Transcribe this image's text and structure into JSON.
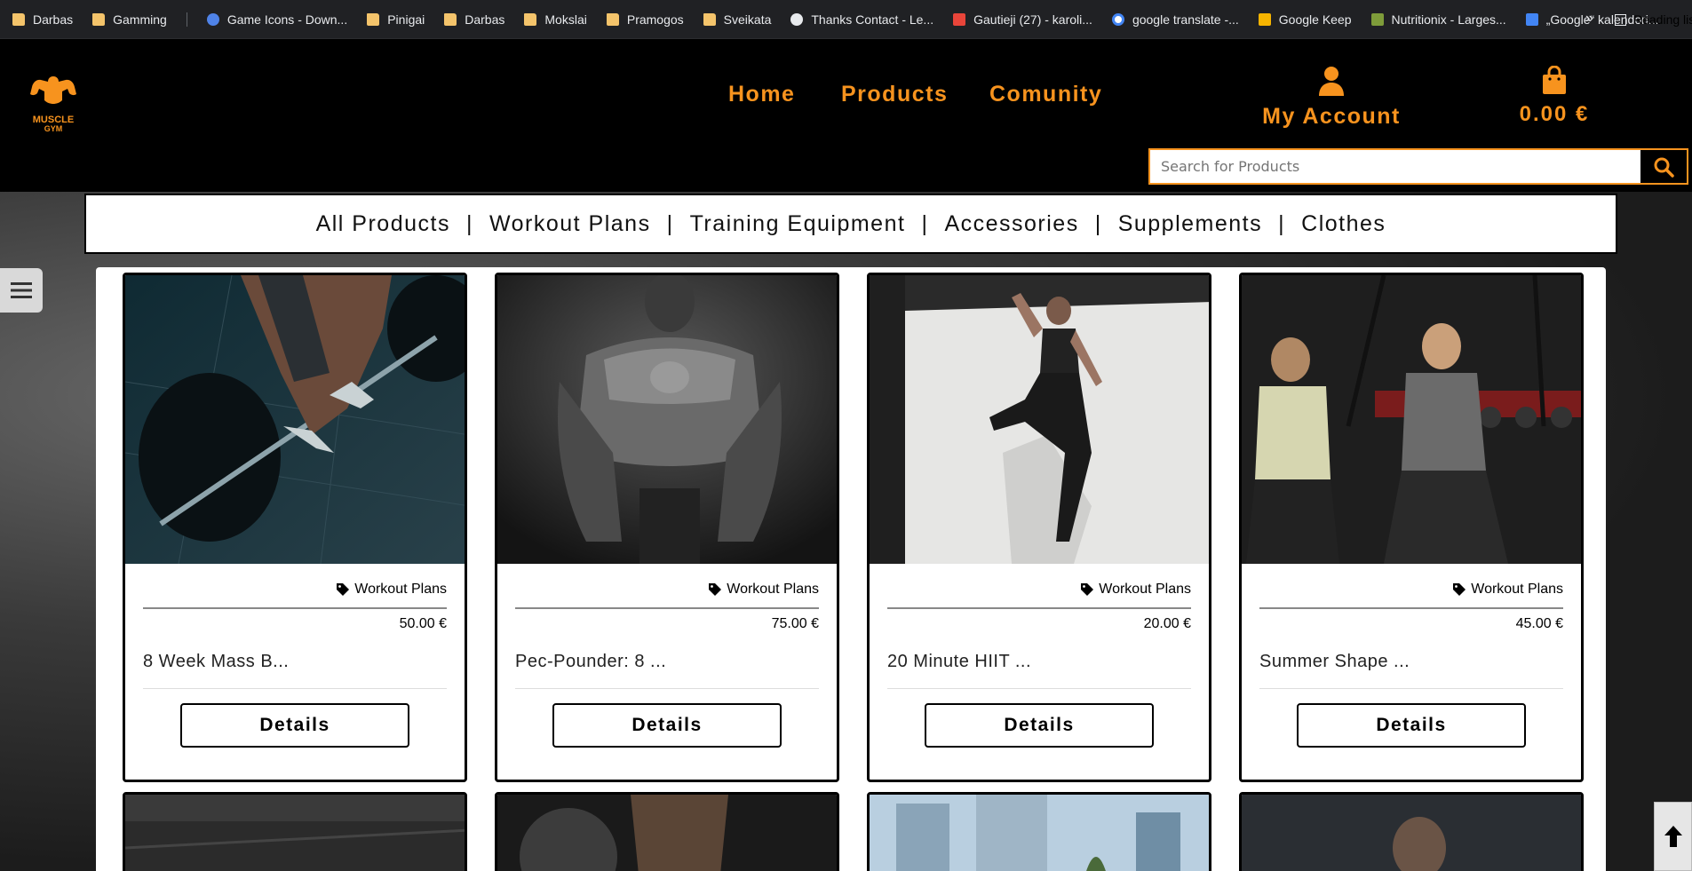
{
  "browser": {
    "bookmarks": [
      {
        "label": "Darbas",
        "icon": "folder"
      },
      {
        "label": "Gamming",
        "icon": "folder"
      },
      {
        "label": "Game Icons - Down...",
        "icon": "blue"
      },
      {
        "label": "Pinigai",
        "icon": "folder"
      },
      {
        "label": "Darbas",
        "icon": "folder"
      },
      {
        "label": "Mokslai",
        "icon": "folder"
      },
      {
        "label": "Pramogos",
        "icon": "folder"
      },
      {
        "label": "Sveikata",
        "icon": "folder"
      },
      {
        "label": "Thanks Contact - Le...",
        "icon": "white"
      },
      {
        "label": "Gautieji (27) - karoli...",
        "icon": "gmail"
      },
      {
        "label": "google translate -...",
        "icon": "g"
      },
      {
        "label": "Google Keep",
        "icon": "keep"
      },
      {
        "label": "Nutritionix - Larges...",
        "icon": "nutri"
      },
      {
        "label": "„Google“ kalendori...",
        "icon": "cal"
      }
    ],
    "more": "»",
    "reading_list": "Reading list"
  },
  "header": {
    "logo_text": [
      "MUSCLE",
      "GYM"
    ],
    "nav": [
      "Home",
      "Products",
      "Comunity"
    ],
    "account_label": "My Account",
    "cart_total": "0.00 €",
    "search_placeholder": "Search for Products"
  },
  "categories": [
    "All Products",
    "Workout Plans",
    "Training Equipment",
    "Accessories",
    "Supplements",
    "Clothes"
  ],
  "products": [
    {
      "category": "Workout Plans",
      "price": "50.00 €",
      "name": "8 Week Mass B...",
      "button": "Details"
    },
    {
      "category": "Workout Plans",
      "price": "75.00 €",
      "name": "Pec-Pounder: 8 ...",
      "button": "Details"
    },
    {
      "category": "Workout Plans",
      "price": "20.00 €",
      "name": "20 Minute HIIT ...",
      "button": "Details"
    },
    {
      "category": "Workout Plans",
      "price": "45.00 €",
      "name": "Summer Shape ...",
      "button": "Details"
    }
  ],
  "colors": {
    "accent": "#f7931e",
    "header_bg": "#000000"
  }
}
